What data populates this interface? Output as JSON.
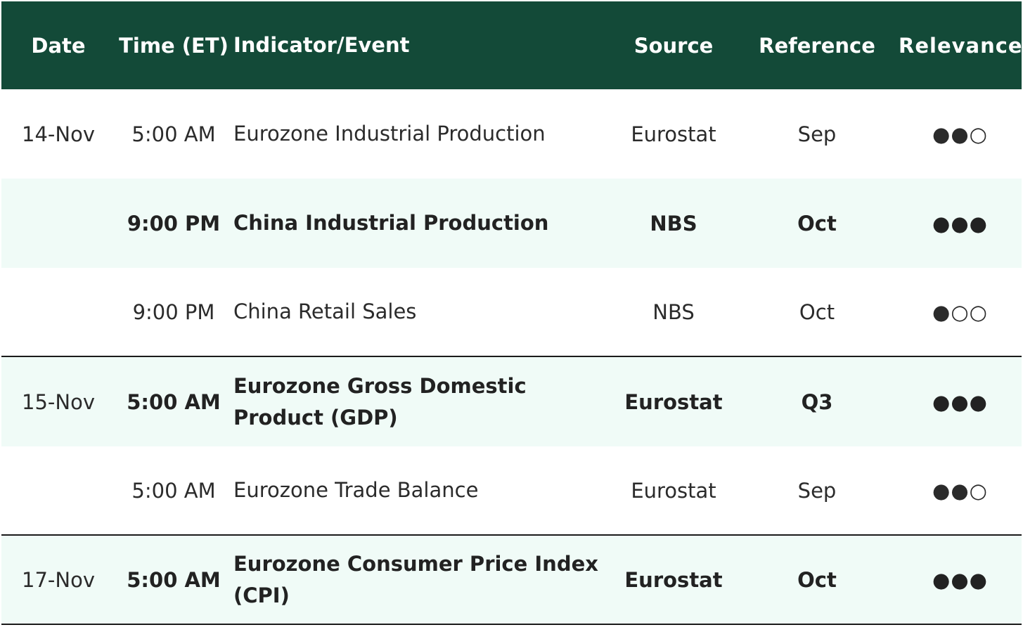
{
  "header": {
    "date": "Date",
    "time": "Time (ET)",
    "event": "Indicator/Event",
    "source": "Source",
    "reference": "Reference",
    "relevance": "Relevance"
  },
  "rows": [
    {
      "date": "14-Nov",
      "time": "5:00 AM",
      "event": "Eurozone Industrial Production",
      "source": "Eurostat",
      "reference": "Sep",
      "relevance": "●●○"
    },
    {
      "date": "",
      "time": "9:00 PM",
      "event": "China Industrial Production",
      "source": "NBS",
      "reference": "Oct",
      "relevance": "●●●"
    },
    {
      "date": "",
      "time": "9:00 PM",
      "event": "China Retail Sales",
      "source": "NBS",
      "reference": "Oct",
      "relevance": "●○○"
    },
    {
      "date": "15-Nov",
      "time": "5:00 AM",
      "event": "Eurozone Gross Domestic Product (GDP)",
      "source": "Eurostat",
      "reference": "Q3",
      "relevance": "●●●"
    },
    {
      "date": "",
      "time": "5:00 AM",
      "event": "Eurozone Trade Balance",
      "source": "Eurostat",
      "reference": "Sep",
      "relevance": "●●○"
    },
    {
      "date": "17-Nov",
      "time": "5:00 AM",
      "event": "Eurozone Consumer Price Index (CPI)",
      "source": "Eurostat",
      "reference": "Oct",
      "relevance": "●●●"
    }
  ],
  "colors": {
    "header_bg": "#134a38",
    "header_text": "#ffffff",
    "shaded_row": "#f0fbf7",
    "divider": "#1a1a1a"
  }
}
